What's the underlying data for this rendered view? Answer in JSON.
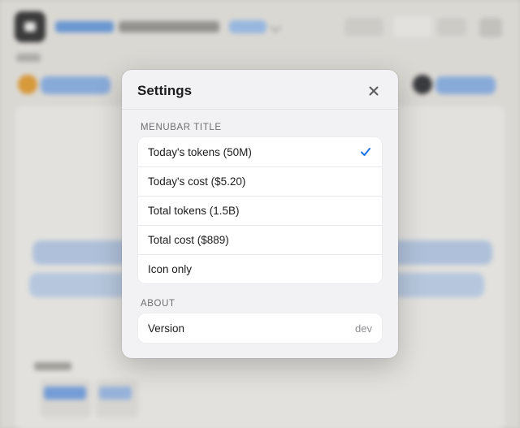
{
  "modal": {
    "title": "Settings",
    "close_icon": "close-icon"
  },
  "menubar": {
    "label": "MENUBAR TITLE",
    "options": [
      {
        "label": "Today's tokens (50M)",
        "selected": true
      },
      {
        "label": "Today's cost ($5.20)",
        "selected": false
      },
      {
        "label": "Total tokens (1.5B)",
        "selected": false
      },
      {
        "label": "Total cost ($889)",
        "selected": false
      },
      {
        "label": "Icon only",
        "selected": false
      }
    ],
    "check_icon": "checkmark-icon"
  },
  "about": {
    "label": "ABOUT",
    "version_label": "Version",
    "version_value": "dev"
  },
  "colors": {
    "accent": "#1a73e8",
    "modal_bg": "#f2f2f4",
    "group_bg": "#ffffff"
  }
}
